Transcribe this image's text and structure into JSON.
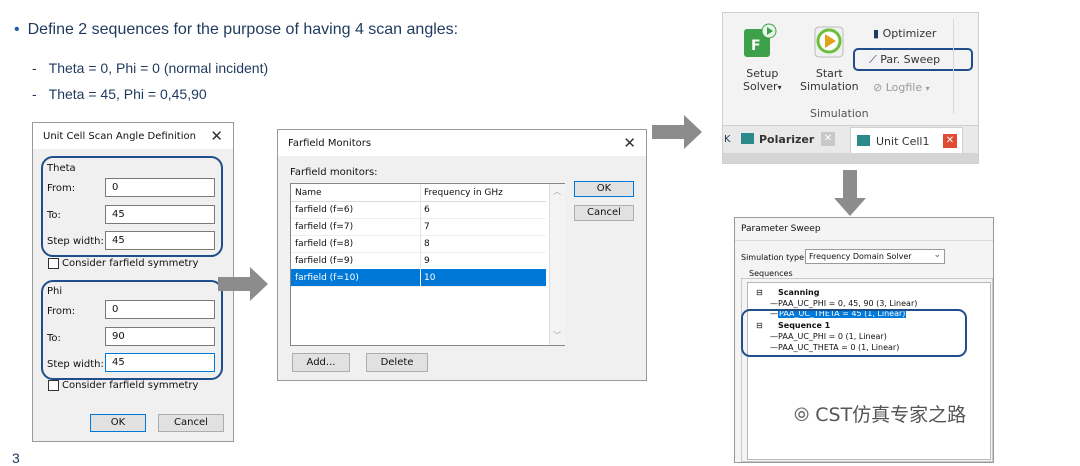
{
  "slide": {
    "bullet": "Define 2 sequences for the purpose of having 4 scan angles:",
    "items": [
      "Theta = 0, Phi = 0 (normal incident)",
      "Theta = 45, Phi = 0,45,90"
    ],
    "footer": "3"
  },
  "scan_dialog": {
    "title": "Unit Cell Scan Angle Definition",
    "theta": {
      "group": "Theta",
      "from_label": "From:",
      "from": "0",
      "to_label": "To:",
      "to": "45",
      "step_label": "Step width:",
      "step": "45",
      "consider": "Consider farfield symmetry"
    },
    "phi": {
      "group": "Phi",
      "from_label": "From:",
      "from": "0",
      "to_label": "To:",
      "to": "90",
      "step_label": "Step width:",
      "step": "45",
      "consider": "Consider farfield symmetry"
    },
    "ok": "OK",
    "cancel": "Cancel"
  },
  "farfield_dialog": {
    "title": "Farfield Monitors",
    "list_label": "Farfield monitors:",
    "columns": [
      "Name",
      "Frequency in GHz"
    ],
    "rows": [
      {
        "name": "farfield (f=6)",
        "freq": "6"
      },
      {
        "name": "farfield (f=7)",
        "freq": "7"
      },
      {
        "name": "farfield (f=8)",
        "freq": "8"
      },
      {
        "name": "farfield (f=9)",
        "freq": "9"
      },
      {
        "name": "farfield (f=10)",
        "freq": "10",
        "selected": true
      }
    ],
    "ok": "OK",
    "cancel": "Cancel",
    "add": "Add...",
    "delete": "Delete"
  },
  "ribbon": {
    "setup_solver": "Setup",
    "setup_solver2": "Solver",
    "start_simulation": "Start",
    "start_simulation2": "Simulation",
    "optimizer": "Optimizer",
    "par_sweep": "Par. Sweep",
    "logfile": "Logfile",
    "group": "Simulation",
    "tabs": [
      "Polarizer",
      "Unit Cell1"
    ]
  },
  "param_sweep": {
    "title": "Parameter Sweep",
    "sim_type_label": "Simulation type:",
    "sim_type": "Frequency Domain Solver",
    "sequences_label": "Sequences",
    "seq1": "Scanning",
    "seq1_items": [
      "PAA_UC_PHI = 0, 45, 90 (3, Linear)",
      "PAA_UC_THETA = 45 (1, Linear)"
    ],
    "seq2": "Sequence 1",
    "seq2_items": [
      "PAA_UC_PHI = 0 (1, Linear)",
      "PAA_UC_THETA = 0 (1, Linear)"
    ]
  },
  "watermark": "CST仿真专家之路",
  "colors": {
    "accent": "#1f4e8c",
    "selection": "#0078d7",
    "arrow": "#8c8c8c",
    "close_red": "#e04b35"
  }
}
